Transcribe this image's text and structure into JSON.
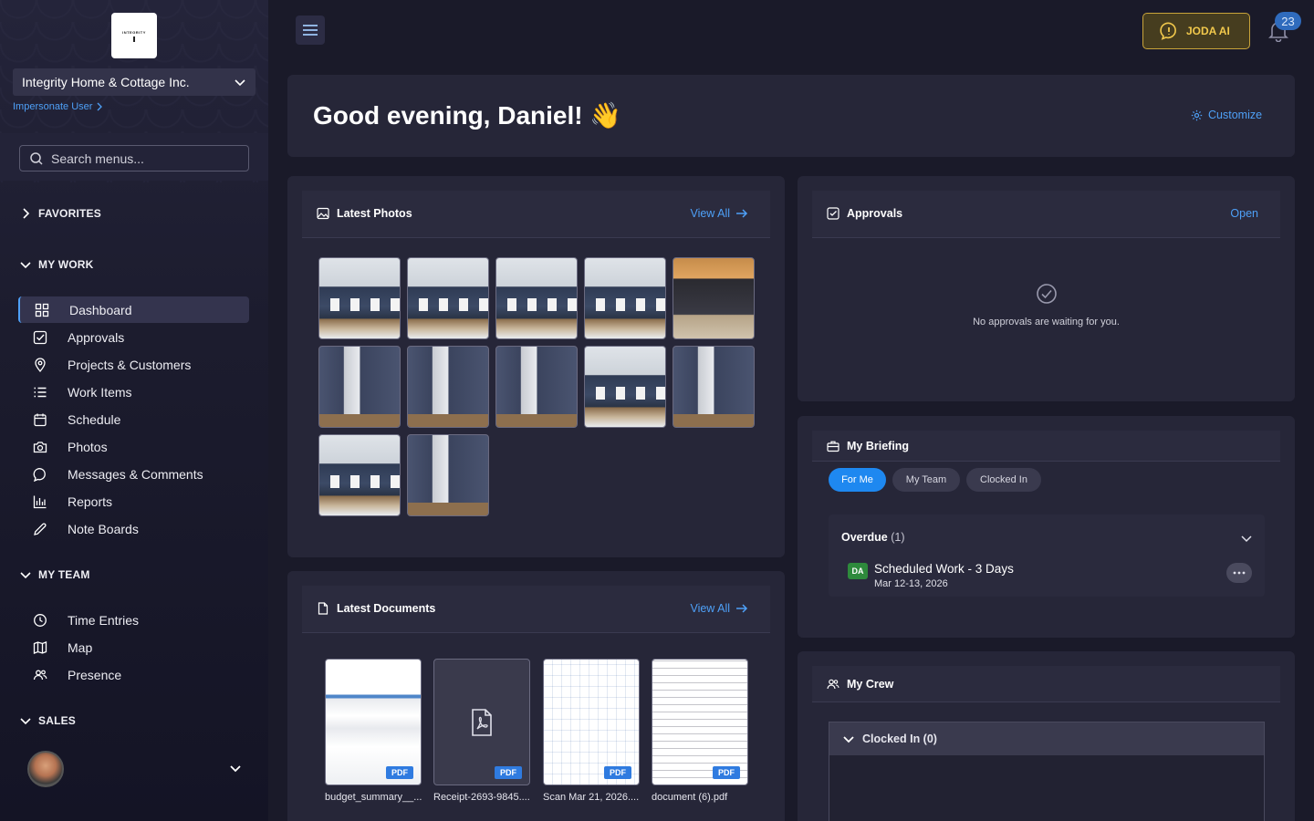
{
  "sidebar": {
    "logo_text": "INTEGRITY",
    "company": "Integrity Home & Cottage Inc.",
    "impersonate": "Impersonate User",
    "search_placeholder": "Search menus...",
    "sections": {
      "favorites": "FAVORITES",
      "my_work": "MY WORK",
      "my_team": "MY TEAM",
      "sales": "SALES"
    },
    "my_work_items": [
      "Dashboard",
      "Approvals",
      "Projects & Customers",
      "Work Items",
      "Schedule",
      "Photos",
      "Messages & Comments",
      "Reports",
      "Note Boards"
    ],
    "my_team_items": [
      "Time Entries",
      "Map",
      "Presence"
    ]
  },
  "topbar": {
    "joda_label": "JODA AI",
    "notification_count": "23"
  },
  "greeting": {
    "text": "Good evening, Daniel! 👋",
    "customize": "Customize"
  },
  "photos": {
    "title": "Latest Photos",
    "view_all": "View All"
  },
  "approvals": {
    "title": "Approvals",
    "open": "Open",
    "empty": "No approvals are waiting for you."
  },
  "documents": {
    "title": "Latest Documents",
    "view_all": "View All",
    "tag": "PDF",
    "files": [
      "budget_summary__...",
      "Receipt-2693-9845....",
      "Scan Mar 21, 2026....",
      "document (6).pdf"
    ]
  },
  "briefing": {
    "title": "My Briefing",
    "tabs": [
      "For Me",
      "My Team",
      "Clocked In"
    ],
    "overdue_label": "Overdue",
    "overdue_count": "(1)",
    "item_initials": "DA",
    "item_title": "Scheduled Work - 3 Days",
    "item_date": "Mar 12-13, 2026"
  },
  "crew": {
    "title": "My Crew",
    "clocked_in": "Clocked In (0)"
  },
  "colors": {
    "accent": "#4ea0f7",
    "primary_pill": "#1e88f0",
    "joda_gold": "#f2c94c",
    "badge": "#2f6bbd"
  }
}
